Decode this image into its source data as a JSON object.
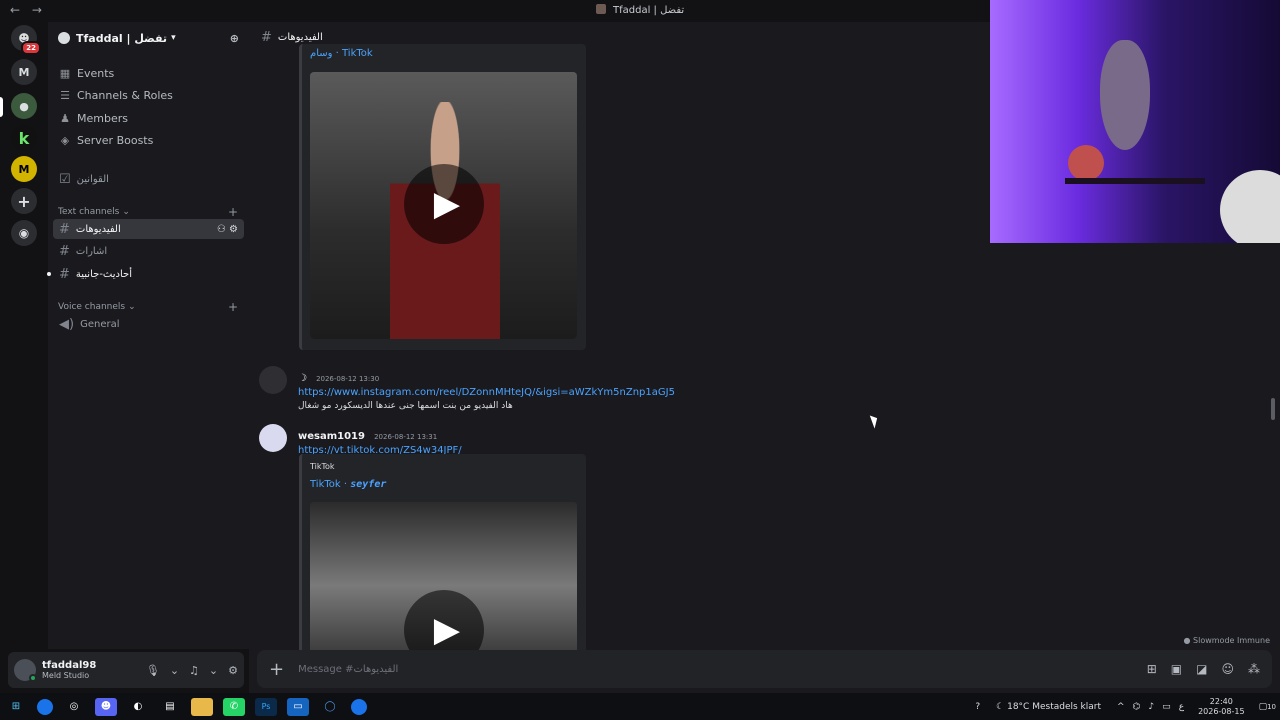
{
  "window": {
    "back": "←",
    "forward": "→",
    "title": "Tfaddal | تفضل"
  },
  "rail": {
    "home_badge": "22",
    "server_m": "M",
    "server_k": "k",
    "server_y": "M"
  },
  "server": {
    "name": "Tfaddal | تفضل"
  },
  "sidebar": {
    "nav": [
      "Events",
      "Channels & Roles",
      "Members",
      "Server Boosts"
    ],
    "rules_channel": "القوانين",
    "text_category": "Text channels",
    "text_channels": [
      "الفيديوهات",
      "اشارات",
      "أحاديث-جانبية"
    ],
    "voice_category": "Voice channels",
    "voice_channels": [
      "General"
    ]
  },
  "user": {
    "name": "tfaddal98",
    "activity": "Meld Studio"
  },
  "channel": {
    "name": "الفيديوهات",
    "slowmode": "Slowmode Immune",
    "composer_placeholder": "Message #الفيديوهات"
  },
  "messages": {
    "embed1_title_cut": "وسام · TikTok",
    "msg1": {
      "author_glyph": "☽",
      "timestamp": "2026-08-12 13:30",
      "link": "https://www.instagram.com/reel/DZonnMHteJQ/&igsi=aWZkYm5nZnp1aGJ5",
      "text": "هاد الفيديو من بنت اسمها جنى عندها الديسكورد مو شغال"
    },
    "msg2": {
      "author": "wesam1019",
      "timestamp": "2026-08-12 13:31",
      "link": "https://vt.tiktok.com/ZS4w34JPF/",
      "embed_provider": "TikTok",
      "embed_title_prefix": "TikTok · ",
      "embed_title_name": "seyfer"
    }
  },
  "taskbar": {
    "temperature": "18°C",
    "weather": "Mestadels klart",
    "lang": "ع",
    "time": "22:40",
    "date": "2026-08-15",
    "notif": "10"
  },
  "colors": {
    "accent_link": "#4aa3ff",
    "online": "#23a55a",
    "badge": "#da373c"
  }
}
